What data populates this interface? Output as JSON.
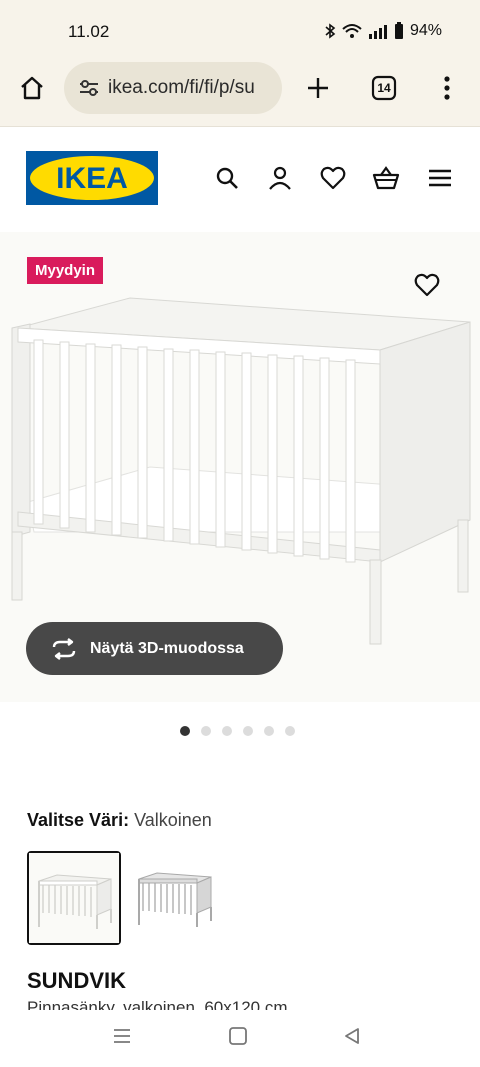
{
  "status": {
    "time": "11.02",
    "battery": "94%"
  },
  "browser": {
    "url": "ikea.com/fi/fi/p/su",
    "tabs_count": "14"
  },
  "header": {
    "logo_text": "IKEA",
    "brand_blue": "#0058a3",
    "brand_yellow": "#ffdb00"
  },
  "product": {
    "badge": "Myydyin",
    "badge_color": "#d91b5c",
    "view3d_label": "Näytä 3D-muodossa",
    "gallery": {
      "total": 6,
      "active": 1
    },
    "color_label": "Valitse Väri:",
    "color_value": "Valkoinen",
    "name": "SUNDVIK",
    "description": "Pinnasänky, valkoinen, 60x120 cm"
  },
  "icons": [
    "home-icon",
    "settings-icon",
    "plus-icon",
    "tabs-icon",
    "more-icon",
    "search-icon",
    "account-icon",
    "heart-icon",
    "basket-icon",
    "menu-icon",
    "rotate-3d-icon"
  ]
}
